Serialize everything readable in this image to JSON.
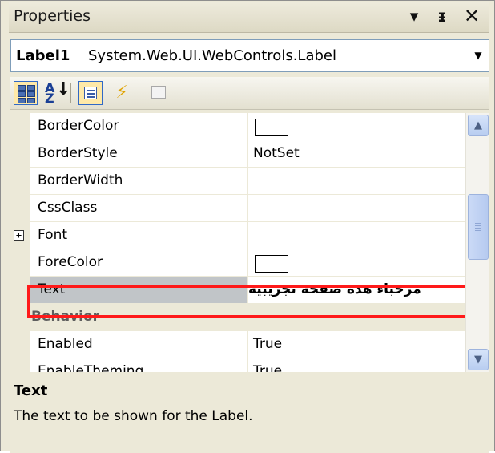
{
  "window": {
    "title": "Properties",
    "dropdown_glyph": "▾",
    "pin_glyph": "ᵻ",
    "close_glyph": "✕"
  },
  "object_selector": {
    "name": "Label1",
    "type": "System.Web.UI.WebControls.Label",
    "arrow_glyph": "▼"
  },
  "toolbar": {
    "categorized": {
      "icon": "categorized-icon",
      "active": true
    },
    "alphabetical": {
      "icon": "sort-alphabetical-icon",
      "label_a": "A",
      "label_z": "Z",
      "arrow": "↓"
    },
    "properties": {
      "icon": "properties-icon",
      "active": true
    },
    "events": {
      "icon": "lightning-icon",
      "glyph": "⚡"
    },
    "property_pages": {
      "icon": "property-pages-icon"
    }
  },
  "grid": {
    "rows": [
      {
        "name": "BorderColor",
        "value": "",
        "swatch": true
      },
      {
        "name": "BorderStyle",
        "value": "NotSet"
      },
      {
        "name": "BorderWidth",
        "value": ""
      },
      {
        "name": "CssClass",
        "value": ""
      },
      {
        "name": "Font",
        "value": "",
        "expander": "+"
      },
      {
        "name": "ForeColor",
        "value": "",
        "swatch": true
      },
      {
        "name": "Text",
        "value": "مرحباء هذه صفحة تجريبية",
        "selected": true
      },
      {
        "category": true,
        "name": "Behavior",
        "expander": "−"
      },
      {
        "name": "Enabled",
        "value": "True"
      },
      {
        "name": "EnableTheming",
        "value": "True"
      }
    ]
  },
  "scrollbar": {
    "up_glyph": "▲",
    "down_glyph": "▼"
  },
  "description": {
    "title": "Text",
    "text": "The text to be shown for the Label."
  },
  "colors": {
    "panel": "#ECE9D8",
    "selected_row": "#C1C5C8",
    "highlight_border": "#FF1A1A",
    "active_button": "#FFE9A8"
  }
}
